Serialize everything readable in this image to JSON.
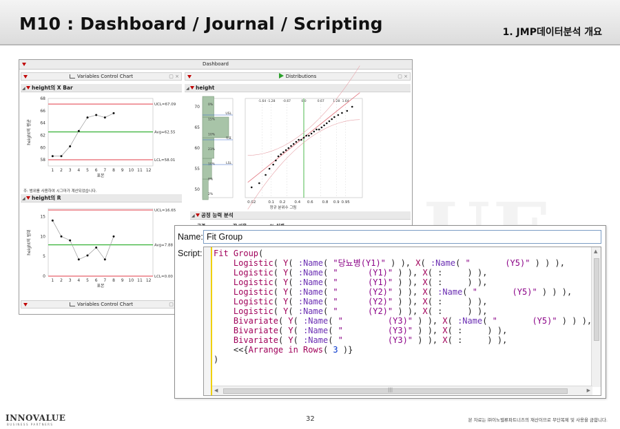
{
  "slide": {
    "title": "M10 : Dashboard / Journal / Scripting",
    "subtitle": "1. JMP데이터분석 개요",
    "page_number": "32",
    "logo": "INNOVALUE",
    "logo_sub": "BUSINESS PARTNERS",
    "copyright": "본 자료는 ㈜이노밸류파트너즈의 재산이므로 무단복제 및 사용을 금합니다."
  },
  "dashboard": {
    "title": "Dashboard",
    "left_panel_title": "Variables Control Chart",
    "right_panel_title": "Distributions",
    "xbar_section": "height의 X Bar",
    "r_section": "height의 R",
    "height_section": "height",
    "capability_section": "공정 능력 분석",
    "capability_cols": [
      "규격",
      "값 비율",
      "% 실제"
    ],
    "bottom_panel_title": "Variables Control Chart",
    "xbar_note": "주: 범위를 사용하여 시그마가 계산되었습니다.",
    "xbar_ylabel": "height의 평균",
    "r_ylabel": "height의 범위",
    "sample_label": "표본",
    "quantile_label": "정규 분위수 그림"
  },
  "chart_data": [
    {
      "type": "line",
      "title": "height의 X Bar",
      "xlabel": "표본",
      "ylabel": "height의 평균",
      "x": [
        1,
        2,
        3,
        4,
        5,
        6,
        7,
        8
      ],
      "values": [
        58.6,
        58.6,
        60.2,
        62.7,
        64.9,
        65.3,
        64.9,
        65.6
      ],
      "xlim": [
        0.5,
        12.5
      ],
      "ylim": [
        57,
        68
      ],
      "yticks": [
        58,
        60,
        62,
        64,
        66,
        68
      ],
      "xticks": [
        1,
        2,
        3,
        4,
        5,
        6,
        7,
        8,
        9,
        10,
        11,
        12
      ],
      "limits": {
        "UCL": 67.09,
        "Avg": 62.55,
        "LCL": 58.01
      },
      "limit_labels": [
        "UCL=67.09",
        "Avg=62.55",
        "LCL=58.01"
      ]
    },
    {
      "type": "line",
      "title": "height의 R",
      "xlabel": "표본",
      "ylabel": "height의 범위",
      "x": [
        1,
        2,
        3,
        4,
        5,
        6,
        7,
        8
      ],
      "values": [
        14,
        10,
        9,
        4.2,
        5.2,
        7.2,
        4.2,
        10
      ],
      "xlim": [
        0.5,
        12.5
      ],
      "ylim": [
        0,
        17
      ],
      "yticks": [
        0,
        5,
        10,
        15
      ],
      "xticks": [
        1,
        2,
        3,
        4,
        5,
        6,
        7,
        8,
        9,
        10,
        11,
        12
      ],
      "limits": {
        "UCL": 16.65,
        "Avg": 7.88,
        "LCL": 0.0
      },
      "limit_labels": [
        "UCL=16.65",
        "Avg=7.88",
        "LCL=0.00"
      ]
    },
    {
      "type": "bar",
      "title": "height",
      "orientation": "horizontal",
      "categories": [
        50,
        55,
        60,
        65,
        70
      ],
      "values": [
        5,
        8,
        10,
        23,
        10
      ],
      "ylim": [
        48,
        72
      ],
      "yticks": [
        50,
        55,
        60,
        65,
        70
      ],
      "bar_labels": [
        "0%",
        "15%",
        "10%",
        "23%",
        "10%",
        "8%",
        "2%"
      ],
      "spec_labels": [
        "USL",
        "목표",
        "LSL"
      ]
    },
    {
      "type": "scatter",
      "title": "정규 분위수 그림",
      "xlabel": "정규 분위수 그림",
      "x_ticks_bottom": [
        "0.02",
        "0.1",
        "0.2",
        "0.4",
        "0.6",
        "0.8",
        "0.9",
        "0.95"
      ],
      "x_ticks_top": [
        "-1.64",
        "-1.28",
        "-0.67",
        "0.0",
        "0.67",
        "1.28",
        "1.64"
      ],
      "x": [
        -2.05,
        -1.75,
        -1.5,
        -1.35,
        -1.2,
        -1.1,
        -1.0,
        -0.9,
        -0.8,
        -0.7,
        -0.6,
        -0.5,
        -0.4,
        -0.3,
        -0.2,
        -0.1,
        0.0,
        0.1,
        0.2,
        0.3,
        0.4,
        0.5,
        0.6,
        0.7,
        0.8,
        0.9,
        1.0,
        1.1,
        1.2,
        1.35,
        1.5,
        1.7,
        1.9
      ],
      "y": [
        50.5,
        51.5,
        53.5,
        55,
        56,
        57,
        58,
        58.5,
        59,
        59.5,
        60,
        60.5,
        61,
        61.5,
        62,
        62,
        62.5,
        63,
        63,
        63.5,
        64,
        64.5,
        64.5,
        65,
        65.5,
        66,
        66.5,
        67,
        67.5,
        68,
        68.5,
        69,
        70
      ],
      "ylim": [
        48,
        72
      ]
    }
  ],
  "script": {
    "name_label": "Name:",
    "name_value": "Fit Group",
    "script_label": "Script:",
    "lines": [
      "Fit Group(",
      "    Logistic( Y( :Name( \"당뇨병(Y1)\" ) ), X( :Name( \"       (Y5)\" ) ) ),",
      "    Logistic( Y( :Name( \"      (Y1)\" ) ), X( :     ) ),",
      "    Logistic( Y( :Name( \"      (Y1)\" ) ), X( :     ) ),",
      "    Logistic( Y( :Name( \"      (Y2)\" ) ), X( :Name( \"       (Y5)\" ) ) ),",
      "    Logistic( Y( :Name( \"      (Y2)\" ) ), X( :     ) ),",
      "    Logistic( Y( :Name( \"      (Y2)\" ) ), X( :     ) ),",
      "    Bivariate( Y( :Name( \"         (Y3)\" ) ), X( :Name( \"       (Y5)\" ) ) ),",
      "    Bivariate( Y( :Name( \"         (Y3)\" ) ), X( :     ) ),",
      "    Bivariate( Y( :Name( \"         (Y3)\" ) ), X( :     ) ),",
      "    <<{Arrange in Rows( 3 )}",
      ")"
    ]
  },
  "colors": {
    "ucl_line": "#e8606a",
    "avg_line": "#22aa22",
    "limit_text": "#333333",
    "point": "#111111",
    "bar_fill": "#a8c4a8",
    "code_keyword": "#a0005a",
    "code_string": "#8a0086",
    "code_number": "#0033cc"
  }
}
